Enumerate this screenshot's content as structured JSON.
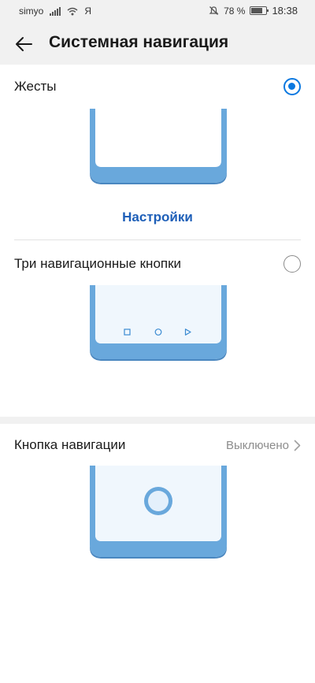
{
  "status_bar": {
    "carrier": "simyo",
    "extra_glyph": "Я",
    "battery_text": "78 %",
    "battery_level": 0.78,
    "time": "18:38",
    "icons": [
      "signal-icon",
      "wifi-icon",
      "mute-icon",
      "battery-icon"
    ]
  },
  "header": {
    "back_icon": "arrow-left-icon",
    "title": "Системная навигация"
  },
  "options": {
    "gestures": {
      "label": "Жесты",
      "selected": true,
      "settings_link": "Настройки"
    },
    "three_buttons": {
      "label": "Три навигационные кнопки",
      "selected": false,
      "nav_icons": [
        "square-icon",
        "circle-icon",
        "triangle-back-icon"
      ]
    },
    "nav_button": {
      "label": "Кнопка навигации",
      "value": "Выключено",
      "chevron_icon": "chevron-right-icon"
    }
  },
  "colors": {
    "accent": "#0a78e0",
    "link": "#1e5fb8",
    "phone_frame": "#69a8dc",
    "phone_frame_dark": "#4a87c0",
    "phone_screen": "#f0f7fd",
    "background": "#f1f1f1"
  }
}
